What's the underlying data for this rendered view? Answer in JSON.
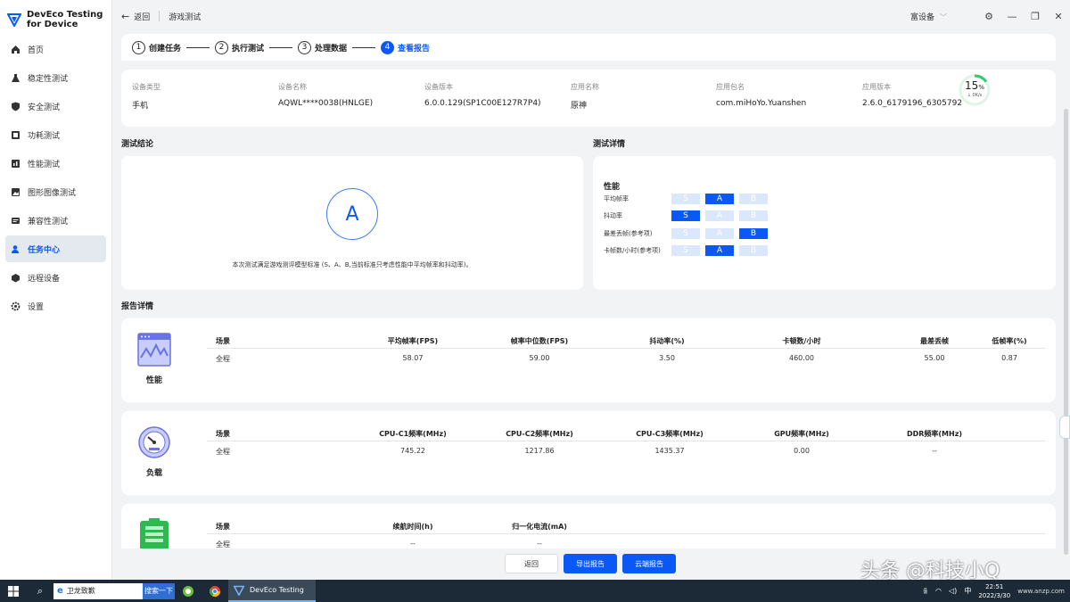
{
  "app": {
    "brand_line1": "DevEco Testing",
    "brand_line2": "for Device"
  },
  "sidebar": {
    "items": [
      {
        "label": "首页",
        "icon": "home-icon"
      },
      {
        "label": "稳定性测试",
        "icon": "flask-icon"
      },
      {
        "label": "安全测试",
        "icon": "shield-icon"
      },
      {
        "label": "功耗测试",
        "icon": "power-icon"
      },
      {
        "label": "性能测试",
        "icon": "performance-icon"
      },
      {
        "label": "图形图像测试",
        "icon": "image-icon"
      },
      {
        "label": "兼容性测试",
        "icon": "compat-icon"
      },
      {
        "label": "任务中心",
        "icon": "user-task-icon",
        "active": true
      },
      {
        "label": "远程设备",
        "icon": "cube-icon"
      },
      {
        "label": "设置",
        "icon": "gear-icon"
      }
    ]
  },
  "titlebar": {
    "back_label": "返回",
    "title": "游戏测试",
    "device": "富设备"
  },
  "steps": [
    {
      "num": "1",
      "label": "创建任务"
    },
    {
      "num": "2",
      "label": "执行测试"
    },
    {
      "num": "3",
      "label": "处理数据"
    },
    {
      "num": "4",
      "label": "查看报告"
    }
  ],
  "info": {
    "cols": [
      {
        "label": "设备类型",
        "value": "手机"
      },
      {
        "label": "设备名称",
        "value": "AQWL****0038(HNLGE)"
      },
      {
        "label": "设备版本",
        "value": "6.0.0.129(SP1C00E127R7P4)"
      },
      {
        "label": "应用名称",
        "value": "原神"
      },
      {
        "label": "应用包名",
        "value": "com.miHoYo.Yuanshen"
      },
      {
        "label": "应用版本",
        "value": "2.6.0_6179196_6305792"
      }
    ],
    "gauge_value": "15",
    "gauge_unit": "%",
    "gauge_fraction": 0.15,
    "gauge_sub": "↓ 0K/s"
  },
  "conclusion": {
    "title": "测试结论",
    "grade": "A",
    "text": "本次测试满足游戏测评模型标准 (S、A、B,当前标准只考虑性能中平均帧率和抖动率)。"
  },
  "detail": {
    "title": "测试详情",
    "heading": "性能",
    "grades": [
      "S",
      "A",
      "B"
    ],
    "rows": [
      {
        "label": "平均帧率",
        "selected": "A"
      },
      {
        "label": "抖动率",
        "selected": "S"
      },
      {
        "label": "最差丢帧(参考项)",
        "selected": "B"
      },
      {
        "label": "卡帧数/小时(参考项)",
        "selected": "A"
      }
    ]
  },
  "report": {
    "title": "报告详情",
    "cards": [
      {
        "caption": "性能",
        "headers": [
          "场景",
          "平均帧率(FPS)",
          "帧率中位数(FPS)",
          "抖动率(%)",
          "卡顿数/小时",
          "最差丢帧",
          "低帧率(%)"
        ],
        "values": [
          "全程",
          "58.07",
          "59.00",
          "3.50",
          "460.00",
          "55.00",
          "0.87"
        ]
      },
      {
        "caption": "负载",
        "headers": [
          "场景",
          "CPU-C1频率(MHz)",
          "CPU-C2频率(MHz)",
          "CPU-C3频率(MHz)",
          "GPU频率(MHz)",
          "DDR频率(MHz)"
        ],
        "values": [
          "全程",
          "745.22",
          "1217.86",
          "1435.37",
          "0.00",
          "--"
        ]
      },
      {
        "caption": "",
        "headers": [
          "场景",
          "续航时间(h)",
          "归一化电流(mA)"
        ],
        "values": [
          "全程",
          "--",
          "--"
        ]
      }
    ]
  },
  "buttons": {
    "back": "返回",
    "export": "导出报告",
    "cloud": "云端报告"
  },
  "watermark": "头条 @科技小Q",
  "taskbar": {
    "search_text": "卫龙致歉",
    "search_button": "搜索一下",
    "active_app": "DevEco Testing",
    "time": "22:51",
    "date": "2022/3/30",
    "site": "www.anzp.com"
  },
  "colors": {
    "accent": "#0a59f7",
    "grade_off": "#dbe8fb",
    "gauge": "#2ecc71"
  }
}
